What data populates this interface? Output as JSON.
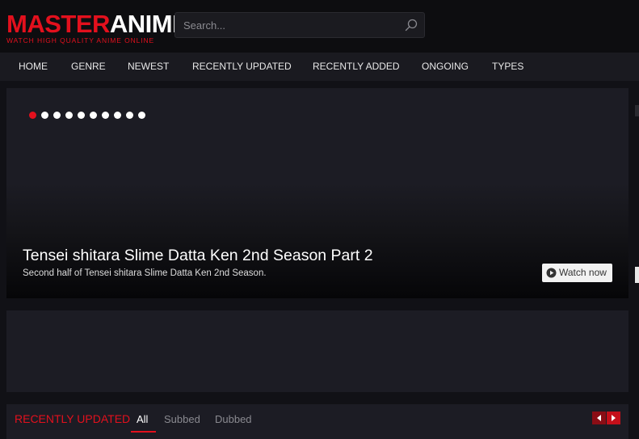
{
  "logo": {
    "part_red": "MASTER",
    "part_white": "ANIME",
    "tagline": "WATCH HIGH QUALITY ANIME ONLINE"
  },
  "search": {
    "placeholder": "Search...",
    "value": "",
    "icon": "search-icon"
  },
  "nav": {
    "items": [
      {
        "label": "HOME"
      },
      {
        "label": "GENRE"
      },
      {
        "label": "NEWEST"
      },
      {
        "label": "RECENTLY UPDATED"
      },
      {
        "label": "RECENTLY ADDED"
      },
      {
        "label": "ONGOING"
      },
      {
        "label": "TYPES"
      }
    ]
  },
  "slider": {
    "slide_count": 10,
    "active_index": 0,
    "title": "Tensei shitara Slime Datta Ken 2nd Season Part 2",
    "description": "Second half of Tensei shitara Slime Datta Ken 2nd Season.",
    "watch_label": "Watch now",
    "watch_icon": "play-circle-icon"
  },
  "recently_updated": {
    "title": "RECENTLY UPDATED",
    "tabs": [
      {
        "label": "All",
        "active": true
      },
      {
        "label": "Subbed",
        "active": false
      },
      {
        "label": "Dubbed",
        "active": false
      }
    ],
    "prev_icon": "caret-left-icon",
    "next_icon": "caret-right-icon"
  },
  "colors": {
    "accent": "#e3101d",
    "background": "#111116",
    "panel": "#1c1c24",
    "nav": "#1a1a20"
  }
}
